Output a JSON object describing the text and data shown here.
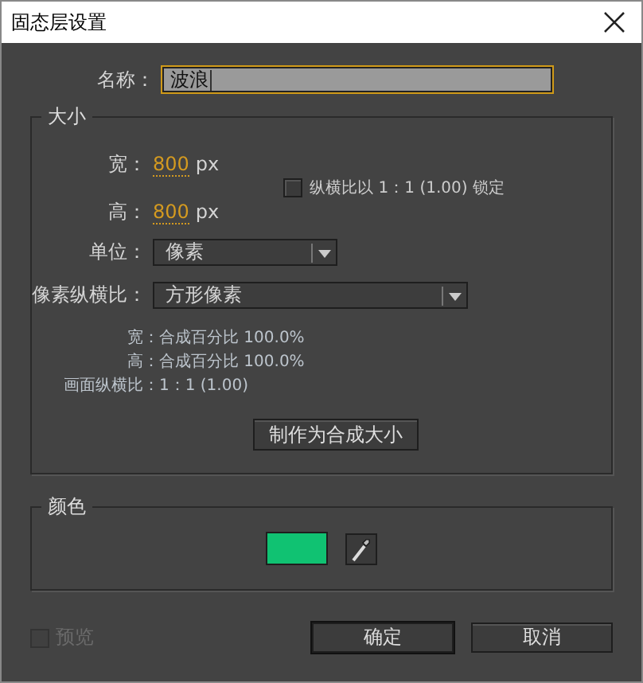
{
  "window": {
    "title": "固态层设置"
  },
  "name": {
    "label": "名称：",
    "value": "波浪"
  },
  "size": {
    "legend": "大小",
    "width": {
      "label": "宽：",
      "value": "800",
      "unit": "px"
    },
    "height": {
      "label": "高：",
      "value": "800",
      "unit": "px"
    },
    "lock": {
      "label": "纵横比以 1：1 (1.00) 锁定",
      "checked": false
    },
    "units": {
      "label": "单位：",
      "value": "像素"
    },
    "pixel_aspect": {
      "label": "像素纵横比：",
      "value": "方形像素"
    },
    "info": [
      {
        "label": "宽：",
        "value": "合成百分比 100.0%"
      },
      {
        "label": "高：",
        "value": "合成百分比 100.0%"
      },
      {
        "label": "画面纵横比：",
        "value": "1：1 (1.00)"
      }
    ],
    "button": "制作为合成大小"
  },
  "color": {
    "legend": "颜色",
    "swatch": {
      "color": "#10c272"
    }
  },
  "preview": {
    "label": "预览",
    "checked": false,
    "disabled": true
  },
  "buttons": [
    {
      "label": "确定",
      "default": true
    },
    {
      "label": "取消",
      "default": false
    }
  ]
}
